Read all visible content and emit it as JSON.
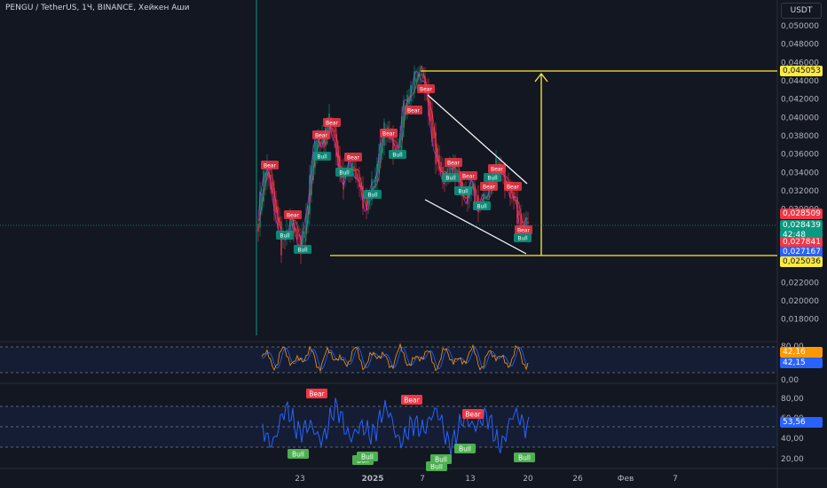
{
  "header": {
    "symbol_title": "PENGU / TetherUS, 1Ч, BINANCE, Хейкен Аши",
    "currency_button": "USDT"
  },
  "price_axis": {
    "ticks": [
      "0,050000",
      "0,048000",
      "0,046000",
      "0,044000",
      "0,042000",
      "0,040000",
      "0,038000",
      "0,036000",
      "0,034000",
      "0,032000",
      "0,030000",
      "0,022000",
      "0,020000",
      "0,018000"
    ]
  },
  "price_labels": [
    {
      "id": "target",
      "text": "0,045053",
      "bg": "#ffeb3b",
      "fg": "#131722",
      "value": 0.045053
    },
    {
      "id": "high",
      "text": "0,028509",
      "bg": "#f23645",
      "fg": "#ffffff",
      "value": 0.028509
    },
    {
      "id": "last",
      "text": "0,028439",
      "bg": "#089981",
      "fg": "#ffffff",
      "value": 0.028439
    },
    {
      "id": "countdown",
      "text": "42:48",
      "bg": "#089981",
      "fg": "#ffffff"
    },
    {
      "id": "low",
      "text": "0,027841",
      "bg": "#f23645",
      "fg": "#ffffff",
      "value": 0.027841
    },
    {
      "id": "blue",
      "text": "0,027167",
      "bg": "#2962ff",
      "fg": "#ffffff",
      "value": 0.027167
    },
    {
      "id": "support",
      "text": "0,025036",
      "bg": "#ffeb3b",
      "fg": "#131722",
      "value": 0.025036
    }
  ],
  "stoch_panel": {
    "ticks": [
      "80,00",
      "0,00"
    ],
    "value_orange": "42,16",
    "value_blue": "42,15",
    "color_k": "#ff9800",
    "color_d": "#2962ff"
  },
  "rsi_panel": {
    "ticks": [
      "80,00",
      "60,00",
      "40,00",
      "20,00"
    ],
    "value": "53,56",
    "bear_label": "Bear",
    "bull_label": "Bull",
    "line_color": "#2962ff"
  },
  "time_axis": {
    "labels": [
      {
        "text": "23",
        "bold": false
      },
      {
        "text": "2025",
        "bold": true
      },
      {
        "text": "7",
        "bold": false
      },
      {
        "text": "13",
        "bold": false
      },
      {
        "text": "20",
        "bold": false
      },
      {
        "text": "26",
        "bold": false
      },
      {
        "text": "Фев",
        "bold": false
      },
      {
        "text": "7",
        "bold": false
      }
    ]
  },
  "colors": {
    "bg": "#131722",
    "up": "#089981",
    "down": "#f23645",
    "yellow": "#ffeb3b",
    "wedge": "#ffffff",
    "grid": "#1e222d"
  },
  "chart_markers": {
    "bull": "Bull",
    "bear": "Bear"
  }
}
